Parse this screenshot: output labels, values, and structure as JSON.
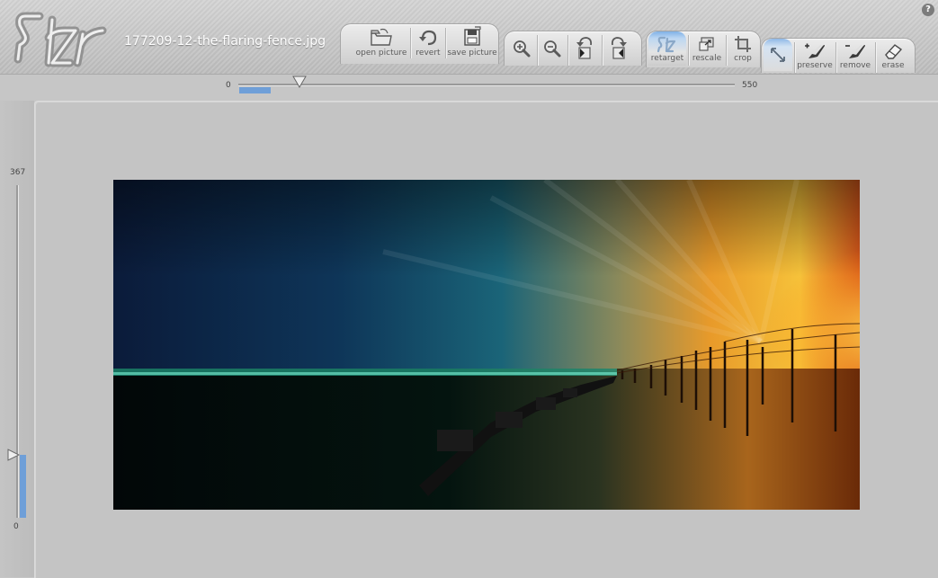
{
  "app": {
    "logo_text": "szr",
    "help_label": "?"
  },
  "file": {
    "name": "177209-12-the-flaring-fence.jpg"
  },
  "toolbar": {
    "file_group": [
      {
        "label": "open picture",
        "icon": "folder-open-icon"
      },
      {
        "label": "revert",
        "icon": "revert-icon"
      },
      {
        "label": "save picture",
        "icon": "floppy-disk-icon"
      }
    ],
    "view_group": [
      {
        "label": "",
        "icon": "zoom-in-icon"
      },
      {
        "label": "",
        "icon": "zoom-out-icon"
      },
      {
        "label": "",
        "icon": "rotate-left-icon"
      },
      {
        "label": "",
        "icon": "rotate-right-icon"
      }
    ],
    "mode_group": [
      {
        "label": "retarget",
        "icon": "retarget-icon",
        "active": true
      },
      {
        "label": "rescale",
        "icon": "rescale-icon",
        "active": false
      },
      {
        "label": "crop",
        "icon": "crop-icon",
        "active": false
      }
    ],
    "mask_group": [
      {
        "label": "",
        "icon": "expand-arrows-icon"
      },
      {
        "label": "preserve",
        "icon": "brush-plus-icon"
      },
      {
        "label": "remove",
        "icon": "brush-minus-icon"
      },
      {
        "label": "erase",
        "icon": "eraser-icon"
      }
    ]
  },
  "width_slider": {
    "min": "0",
    "max": "550",
    "value_fraction": 0.063
  },
  "height_slider": {
    "min": "0",
    "max": "367",
    "value_fraction": 0.19
  },
  "colors": {
    "accent": "#6f9fd8",
    "background": "#c4c4c4",
    "tab": "#e2e2e2"
  },
  "picture": {
    "description_icon": "photo-image"
  }
}
